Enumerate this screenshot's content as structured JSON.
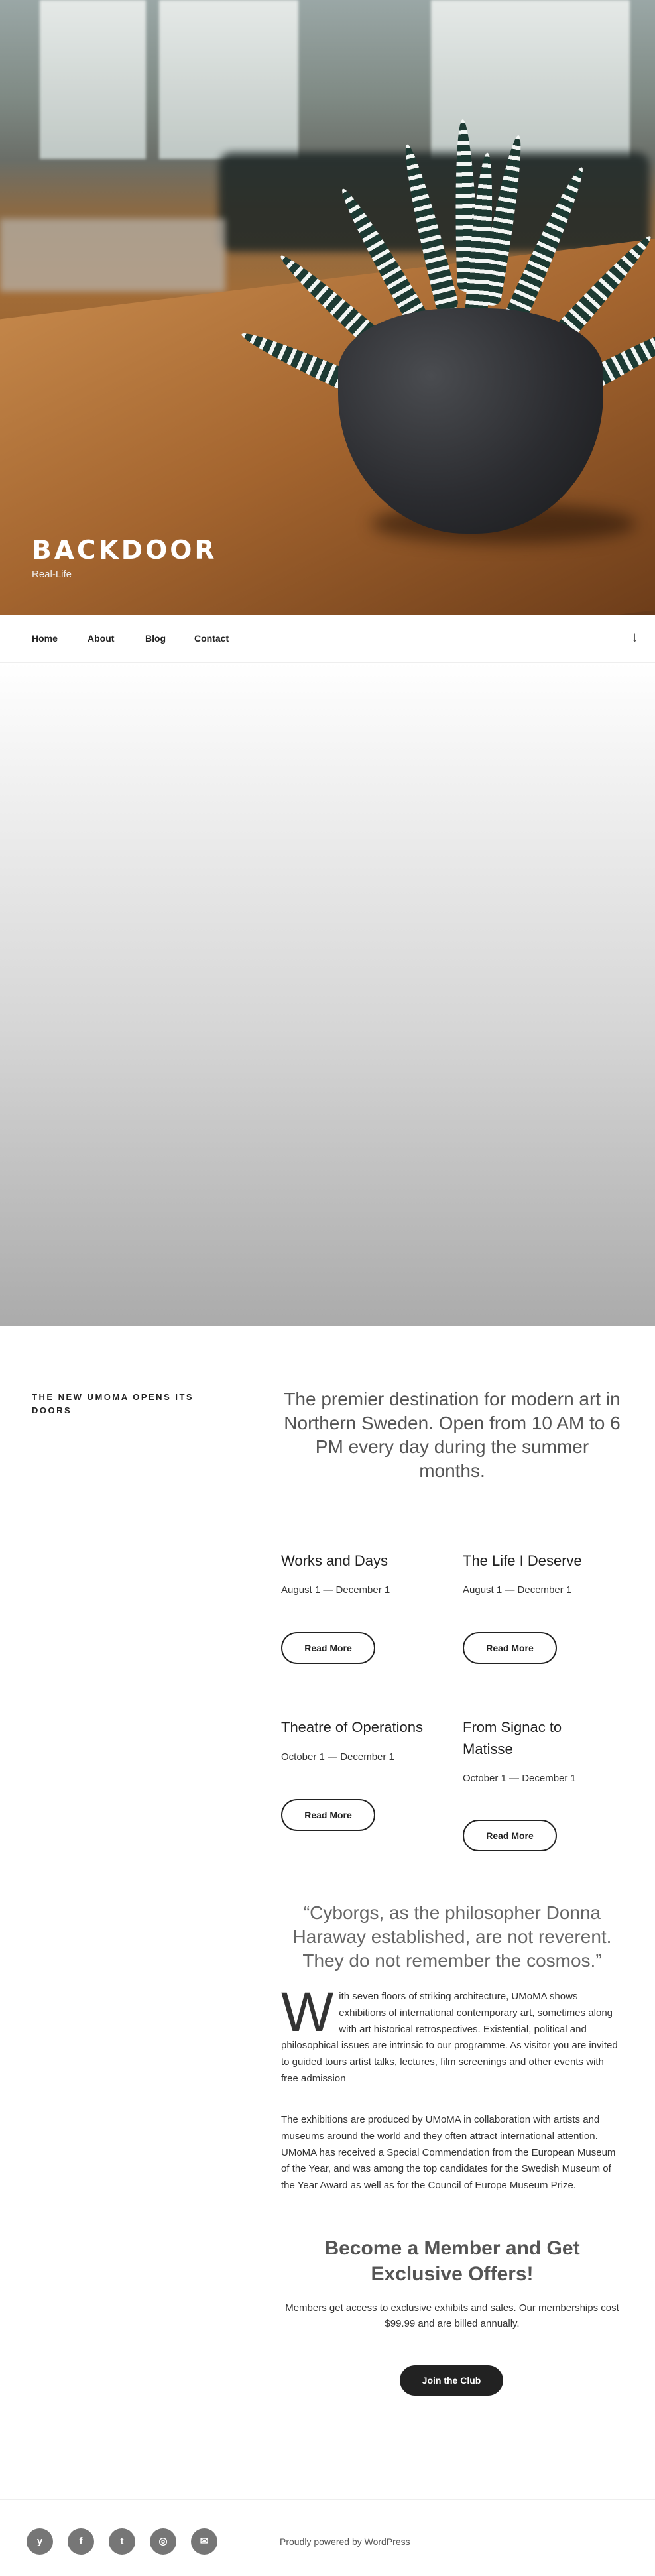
{
  "site": {
    "title": "BACKDOOR",
    "description": "Real-Life"
  },
  "nav": {
    "items": [
      "Home",
      "About",
      "Blog",
      "Contact"
    ],
    "scroll_icon": "arrow-down-icon"
  },
  "section": {
    "title": "THE NEW UMOMA OPENS ITS DOORS",
    "intro": "The premier destination for modern art in Northern Sweden. Open from 10 AM to 6 PM every day during the summer months."
  },
  "exhibits": [
    {
      "title": "Works and Days",
      "date": "August 1 — December 1",
      "button": "Read More"
    },
    {
      "title": "The Life I Deserve",
      "date": "August 1 — December 1",
      "button": "Read More"
    },
    {
      "title": "Theatre of Operations",
      "date": "October 1 — December 1",
      "button": "Read More"
    },
    {
      "title": "From Signac to Matisse",
      "date": "October 1 — December 1",
      "button": "Read More"
    }
  ],
  "quote": "“Cyborgs, as the philosopher Donna Haraway established, are not reverent. They do not remember the cosmos.”",
  "body": {
    "dropcap": "W",
    "para1": "ith seven floors of striking architecture, UMoMA shows exhibitions of international contemporary art, sometimes along with art historical retrospectives. Existential, political and philosophical issues are intrinsic to our programme. As visitor you are invited to guided tours artist talks, lectures, film screenings and other events with free admission",
    "para2": "The exhibitions are produced by UMoMA in collaboration with artists and museums around the world and they often attract international attention. UMoMA has received a Special Commendation from the European Museum of the Year, and was among the top candidates for the Swedish Museum of the Year Award as well as for the Council of Europe Museum Prize."
  },
  "membership": {
    "heading": "Become a Member and Get Exclusive Offers!",
    "text": "Members get access to exclusive exhibits and sales. Our memberships cost $99.99 and are billed annually.",
    "button": "Join the Club"
  },
  "footer": {
    "social": [
      {
        "icon": "yelp-icon",
        "glyph": "y"
      },
      {
        "icon": "facebook-icon",
        "glyph": "f"
      },
      {
        "icon": "twitter-icon",
        "glyph": "t"
      },
      {
        "icon": "instagram-icon",
        "glyph": "◎"
      },
      {
        "icon": "email-icon",
        "glyph": "✉"
      }
    ],
    "powered": "Proudly powered by WordPress"
  }
}
